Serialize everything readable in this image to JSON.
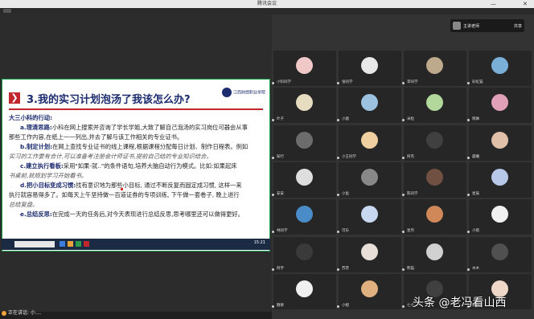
{
  "window": {
    "title": "腾讯会议",
    "minimize_glyph": "—",
    "close_glyph": "✕"
  },
  "slide": {
    "number_icon": "❯",
    "title": "3.我的实习计划泡汤了我该怎么办?",
    "logo_text": "江西财经职业学院",
    "lines": [
      {
        "kind": "sec",
        "text": "大三小科的行动:"
      },
      {
        "kind": "para",
        "lead": "a.理清思路:",
        "text": "小科在网上搜索并咨询了学长学姐,大致了解自己泡汤的实习岗位可器会从事"
      },
      {
        "kind": "cont",
        "text": "那些工作内容,在纸上一一列出,并去了解与该工作相关的专业证书。"
      },
      {
        "kind": "para",
        "lead": "b.制定计划:",
        "text": "在网上查找专业证书的线上课程,根据课程分配每日计划、制作日程表。例如"
      },
      {
        "kind": "hand",
        "text": "实习的工作要有合计,可以准备考注册会计师证书,提前自己结的专业知识结合。"
      },
      {
        "kind": "para",
        "lead": "c.建立执行看板:",
        "text": "采用\"如果-就..\"的条件语句,培养大脑自动行为模式。比如:如果起床"
      },
      {
        "kind": "hand",
        "text": "书桌前,就规划学习开始看书。"
      },
      {
        "kind": "para",
        "lead": "d.把小目标变成习惯:",
        "text": "找有意识地为那些小目标, 通过不断反复而固定成习惯, 这样一来"
      },
      {
        "kind": "cont",
        "text": "执行就容易得多了。如每天上午坚持做一百道证券的专项训练, 下午做一套卷子, 晚上进行"
      },
      {
        "kind": "hand",
        "text": "总结复盘。"
      },
      {
        "kind": "para",
        "lead": "e.总结反思:",
        "text": "在完成一天的任务后,对今天表现进行总结反思,思考哪里还可以做得更好。"
      }
    ]
  },
  "taskbar": {
    "clock": "15:21"
  },
  "status": {
    "speaking_label": "正在讲话: 小...."
  },
  "speaker": {
    "name": "主讲老师",
    "tag": "共享"
  },
  "participants": [
    {
      "name": "小科同学",
      "color": "#f0c8c8"
    },
    {
      "name": "张同学",
      "color": "#e8e8e8"
    },
    {
      "name": "李同学",
      "color": "#bda98c"
    },
    {
      "name": "彩虹猫",
      "color": "#7ab0d8"
    },
    {
      "name": "叶子",
      "color": "#e6dcc0"
    },
    {
      "name": "小鹿",
      "color": "#9cc2e0"
    },
    {
      "name": "米粒",
      "color": "#b2d89c"
    },
    {
      "name": "晓琳",
      "color": "#e0a0b8"
    },
    {
      "name": "知行",
      "color": "#6c6c6c"
    },
    {
      "name": "小王同学",
      "color": "#f0d0a0"
    },
    {
      "name": "阿杰",
      "color": "#404040"
    },
    {
      "name": "晨曦",
      "color": "#e0c0a8"
    },
    {
      "name": "安安",
      "color": "#dedede"
    },
    {
      "name": "小鱼",
      "color": "#888888"
    },
    {
      "name": "陈同学",
      "color": "#705040"
    },
    {
      "name": "星辰",
      "color": "#b8c8e8"
    },
    {
      "name": "林同学",
      "color": "#4a8cc8"
    },
    {
      "name": "可乐",
      "color": "#c8d8f0"
    },
    {
      "name": "星月",
      "color": "#d08858"
    },
    {
      "name": "小雨",
      "color": "#f0f0f0"
    },
    {
      "name": "阿宇",
      "color": "#3a3a3a"
    },
    {
      "name": "苏苏",
      "color": "#e8e0d8"
    },
    {
      "name": "熊猫",
      "color": "#d0d0d0"
    },
    {
      "name": "木木",
      "color": "#505050"
    },
    {
      "name": "糖果",
      "color": "#f0f0f0"
    },
    {
      "name": "小橙",
      "color": "#e0b080"
    },
    {
      "name": "七七",
      "color": "#404040"
    },
    {
      "name": "暖阳",
      "color": "#f0d8c8"
    }
  ],
  "watermark": "头条 @老冯看山西"
}
